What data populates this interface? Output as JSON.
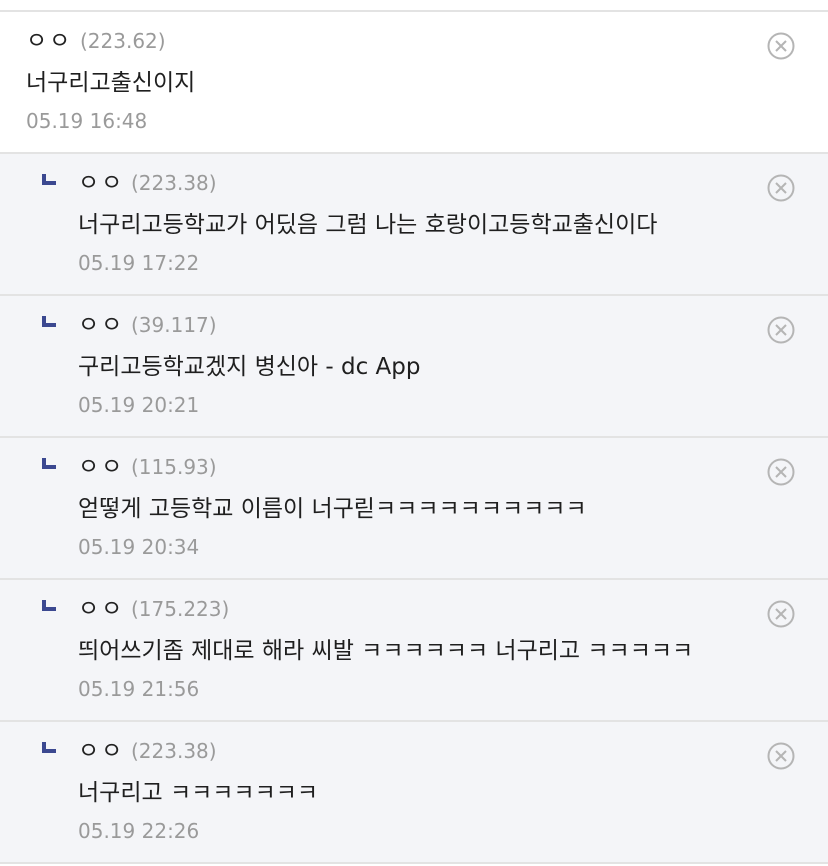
{
  "comments": [
    {
      "nick": "ㅇㅇ",
      "ip": "(223.62)",
      "text": "너구리고출신이지",
      "date": "05.19 16:48",
      "reply": false
    },
    {
      "nick": "ㅇㅇ",
      "ip": "(223.38)",
      "text": "너구리고등학교가 어딨음 그럼 나는 호랑이고등학교출신이다",
      "date": "05.19 17:22",
      "reply": true
    },
    {
      "nick": "ㅇㅇ",
      "ip": "(39.117)",
      "text": "구리고등학교겠지 병신아 - dc App",
      "date": "05.19 20:21",
      "reply": true
    },
    {
      "nick": "ㅇㅇ",
      "ip": "(115.93)",
      "text": "얻떻게 고등학교 이름이 너구릳ㅋㅋㅋㅋㅋㅋㅋㅋㅋㅋ",
      "date": "05.19 20:34",
      "reply": true
    },
    {
      "nick": "ㅇㅇ",
      "ip": "(175.223)",
      "text": "띄어쓰기좀 제대로 해라 씨발 ㅋㅋㅋㅋㅋㅋ 너구리고 ㅋㅋㅋㅋㅋ",
      "date": "05.19 21:56",
      "reply": true
    },
    {
      "nick": "ㅇㅇ",
      "ip": "(223.38)",
      "text": "너구리고 ㅋㅋㅋㅋㅋㅋㅋ",
      "date": "05.19 22:26",
      "reply": true
    }
  ],
  "colors": {
    "reply_bg": "#f4f5f8",
    "reply_marker": "#3b4890",
    "divider": "#e3e3e3",
    "meta_text": "#9a9a9a"
  },
  "icons": {
    "delete": "circle-x-icon",
    "reply": "reply-arrow-icon"
  }
}
